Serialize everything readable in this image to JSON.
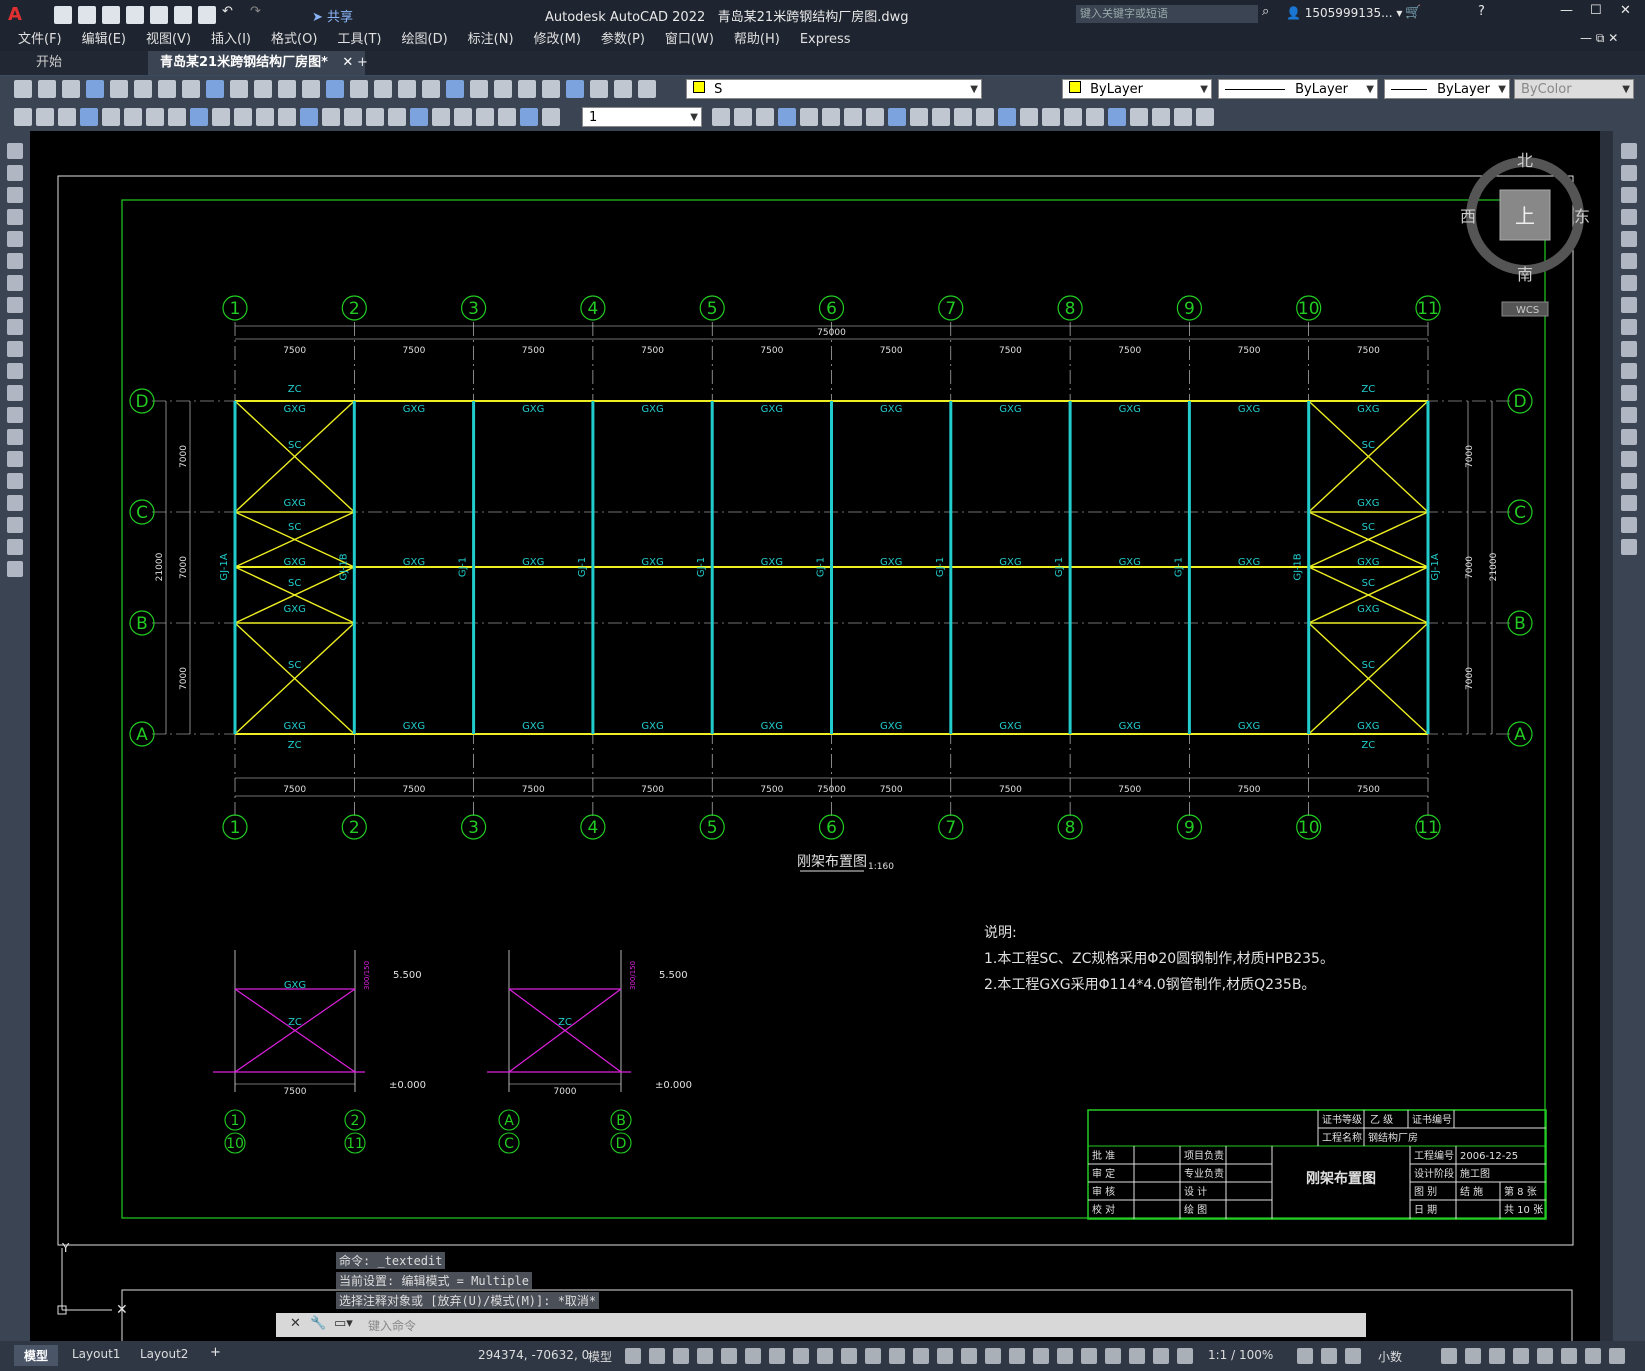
{
  "app": {
    "title": "Autodesk AutoCAD 2022",
    "filename": "青岛某21米跨钢结构厂房图.dwg",
    "search_placeholder": "键入关键字或短语",
    "user": "1505999135...",
    "share": "共享"
  },
  "menu": [
    "文件(F)",
    "编辑(E)",
    "视图(V)",
    "插入(I)",
    "格式(O)",
    "工具(T)",
    "绘图(D)",
    "标注(N)",
    "修改(M)",
    "参数(P)",
    "窗口(W)",
    "帮助(H)",
    "Express"
  ],
  "tabs": {
    "start": "开始",
    "active": "青岛某21米跨钢结构厂房图*",
    "add": "+"
  },
  "toolbar": {
    "layer_value": "S",
    "color_value": "ByLayer",
    "linetype_value": "ByLayer",
    "lineweight_value": "ByLayer",
    "plotstyle_value": "ByColor",
    "dimscale_value": "1"
  },
  "viewcube": {
    "north": "北",
    "south": "南",
    "east": "东",
    "west": "西",
    "top": "上",
    "wcs": "WCS"
  },
  "drawing": {
    "col_labels": [
      "1",
      "2",
      "3",
      "4",
      "5",
      "6",
      "7",
      "8",
      "9",
      "10",
      "11"
    ],
    "row_labels": [
      "D",
      "C",
      "B",
      "A"
    ],
    "span_dim": "7500",
    "total_dim": "75000",
    "bay_dim": "7000",
    "total_width": "21000",
    "gxg": "GXG",
    "zc": "ZC",
    "sc": "SC",
    "gj1": "GJ-1",
    "gj1a": "GJ-1A",
    "gj1b": "GJ-1B",
    "plan_title": "刚架布置图",
    "plan_scale": "1:160",
    "notes_title": "说明:",
    "note1": "1.本工程SC、ZC规格采用Φ20圆钢制作,材质HPB235。",
    "note2": "2.本工程GXG采用Φ114*4.0钢管制作,材质Q235B。",
    "elev1": "5.500",
    "elev0": "±0.000",
    "detail1_dim": "7500",
    "detail2_dim": "7000",
    "detail1_top": [
      "1",
      "2"
    ],
    "detail1_bot": [
      "10",
      "11"
    ],
    "detail2_top": [
      "A",
      "B"
    ],
    "detail2_bot": [
      "C",
      "D"
    ],
    "side_dim": "300/150"
  },
  "titleblock": {
    "cert_level": "证书等级",
    "level": "乙 级",
    "cert_no": "证书编号",
    "project_name_label": "工程名称",
    "project_name": "钢结构厂房",
    "r1": [
      "批 准",
      "项目负责"
    ],
    "r2": [
      "审 定",
      "专业负责"
    ],
    "r3": [
      "审 核",
      "设 计"
    ],
    "r4": [
      "校 对",
      "绘 图"
    ],
    "drawing_name": "刚架布置图",
    "proj_no_label": "工程编号",
    "date": "2006-12-25",
    "phase_label": "设计阶段",
    "phase": "施工图",
    "sheet_label": "图 别",
    "sheet_type": "结 施",
    "sheet_no": "第 8 张",
    "date_label": "日 期",
    "total": "共 10 张"
  },
  "command": {
    "line1": "命令: _textedit",
    "line2": "当前设置: 编辑模式 = Multiple",
    "line3": "选择注释对象或 [放弃(U)/模式(M)]: *取消*",
    "placeholder": "键入命令"
  },
  "status": {
    "model_tab": "模型",
    "layout1": "Layout1",
    "layout2": "Layout2",
    "coords": "294374, -70632, 0",
    "model": "模型",
    "scale": "1:1 / 100%",
    "units": "小数"
  },
  "colors": {
    "grid": "#22cc22",
    "cyan": "#22cccc",
    "yellow": "#eeee22",
    "magenta": "#dd22dd",
    "white": "#e0e0e0"
  }
}
